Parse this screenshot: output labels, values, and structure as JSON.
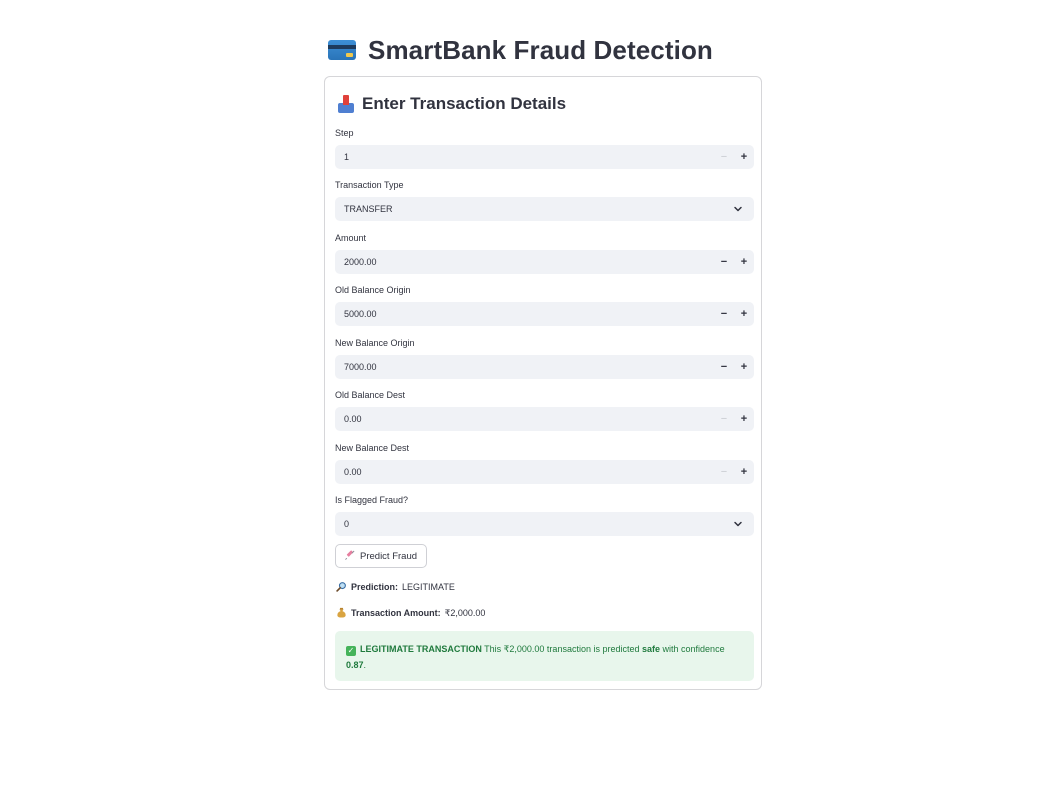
{
  "app": {
    "title": "SmartBank Fraud Detection",
    "title_icon": "credit-card-icon"
  },
  "form": {
    "header": "Enter Transaction Details",
    "header_icon": "inbox-tray-icon",
    "fields": {
      "step": {
        "label": "Step",
        "value": "1"
      },
      "transaction_type": {
        "label": "Transaction Type",
        "value": "TRANSFER"
      },
      "amount": {
        "label": "Amount",
        "value": "2000.00"
      },
      "old_balance_origin": {
        "label": "Old Balance Origin",
        "value": "5000.00"
      },
      "new_balance_origin": {
        "label": "New Balance Origin",
        "value": "7000.00"
      },
      "old_balance_dest": {
        "label": "Old Balance Dest",
        "value": "0.00"
      },
      "new_balance_dest": {
        "label": "New Balance Dest",
        "value": "0.00"
      },
      "is_flagged_fraud": {
        "label": "Is Flagged Fraud?",
        "value": "0"
      }
    },
    "stepper_minus": "−",
    "stepper_plus": "+",
    "predict_button": {
      "label": "Predict Fraud",
      "icon": "syringe-icon"
    }
  },
  "results": {
    "prediction_label": "Prediction:",
    "prediction_value": "LEGITIMATE",
    "prediction_icon": "magnifier-icon",
    "amount_label": "Transaction Amount:",
    "amount_value": "₹2,000.00",
    "amount_icon": "money-bag-icon"
  },
  "alert": {
    "icon": "check-mark-icon",
    "title": "LEGITIMATE TRANSACTION",
    "text_1": "This ₹2,000.00 transaction is predicted",
    "strong": "safe",
    "text_2": "with confidence",
    "confidence": "0.87",
    "end": "."
  },
  "colors": {
    "success_bg": "#e8f6ec",
    "success_text": "#1f7a3d",
    "input_bg": "#f0f2f6"
  }
}
